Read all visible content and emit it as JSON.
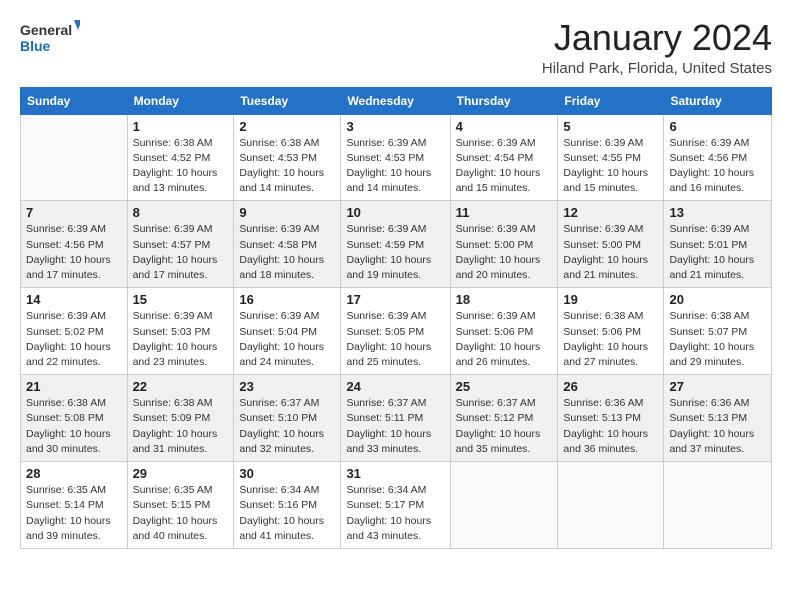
{
  "logo": {
    "line1": "General",
    "line2": "Blue"
  },
  "title": "January 2024",
  "subtitle": "Hiland Park, Florida, United States",
  "headers": [
    "Sunday",
    "Monday",
    "Tuesday",
    "Wednesday",
    "Thursday",
    "Friday",
    "Saturday"
  ],
  "weeks": [
    [
      {
        "day": "",
        "info": ""
      },
      {
        "day": "1",
        "info": "Sunrise: 6:38 AM\nSunset: 4:52 PM\nDaylight: 10 hours\nand 13 minutes."
      },
      {
        "day": "2",
        "info": "Sunrise: 6:38 AM\nSunset: 4:53 PM\nDaylight: 10 hours\nand 14 minutes."
      },
      {
        "day": "3",
        "info": "Sunrise: 6:39 AM\nSunset: 4:53 PM\nDaylight: 10 hours\nand 14 minutes."
      },
      {
        "day": "4",
        "info": "Sunrise: 6:39 AM\nSunset: 4:54 PM\nDaylight: 10 hours\nand 15 minutes."
      },
      {
        "day": "5",
        "info": "Sunrise: 6:39 AM\nSunset: 4:55 PM\nDaylight: 10 hours\nand 15 minutes."
      },
      {
        "day": "6",
        "info": "Sunrise: 6:39 AM\nSunset: 4:56 PM\nDaylight: 10 hours\nand 16 minutes."
      }
    ],
    [
      {
        "day": "7",
        "info": "Sunrise: 6:39 AM\nSunset: 4:56 PM\nDaylight: 10 hours\nand 17 minutes."
      },
      {
        "day": "8",
        "info": "Sunrise: 6:39 AM\nSunset: 4:57 PM\nDaylight: 10 hours\nand 17 minutes."
      },
      {
        "day": "9",
        "info": "Sunrise: 6:39 AM\nSunset: 4:58 PM\nDaylight: 10 hours\nand 18 minutes."
      },
      {
        "day": "10",
        "info": "Sunrise: 6:39 AM\nSunset: 4:59 PM\nDaylight: 10 hours\nand 19 minutes."
      },
      {
        "day": "11",
        "info": "Sunrise: 6:39 AM\nSunset: 5:00 PM\nDaylight: 10 hours\nand 20 minutes."
      },
      {
        "day": "12",
        "info": "Sunrise: 6:39 AM\nSunset: 5:00 PM\nDaylight: 10 hours\nand 21 minutes."
      },
      {
        "day": "13",
        "info": "Sunrise: 6:39 AM\nSunset: 5:01 PM\nDaylight: 10 hours\nand 21 minutes."
      }
    ],
    [
      {
        "day": "14",
        "info": "Sunrise: 6:39 AM\nSunset: 5:02 PM\nDaylight: 10 hours\nand 22 minutes."
      },
      {
        "day": "15",
        "info": "Sunrise: 6:39 AM\nSunset: 5:03 PM\nDaylight: 10 hours\nand 23 minutes."
      },
      {
        "day": "16",
        "info": "Sunrise: 6:39 AM\nSunset: 5:04 PM\nDaylight: 10 hours\nand 24 minutes."
      },
      {
        "day": "17",
        "info": "Sunrise: 6:39 AM\nSunset: 5:05 PM\nDaylight: 10 hours\nand 25 minutes."
      },
      {
        "day": "18",
        "info": "Sunrise: 6:39 AM\nSunset: 5:06 PM\nDaylight: 10 hours\nand 26 minutes."
      },
      {
        "day": "19",
        "info": "Sunrise: 6:38 AM\nSunset: 5:06 PM\nDaylight: 10 hours\nand 27 minutes."
      },
      {
        "day": "20",
        "info": "Sunrise: 6:38 AM\nSunset: 5:07 PM\nDaylight: 10 hours\nand 29 minutes."
      }
    ],
    [
      {
        "day": "21",
        "info": "Sunrise: 6:38 AM\nSunset: 5:08 PM\nDaylight: 10 hours\nand 30 minutes."
      },
      {
        "day": "22",
        "info": "Sunrise: 6:38 AM\nSunset: 5:09 PM\nDaylight: 10 hours\nand 31 minutes."
      },
      {
        "day": "23",
        "info": "Sunrise: 6:37 AM\nSunset: 5:10 PM\nDaylight: 10 hours\nand 32 minutes."
      },
      {
        "day": "24",
        "info": "Sunrise: 6:37 AM\nSunset: 5:11 PM\nDaylight: 10 hours\nand 33 minutes."
      },
      {
        "day": "25",
        "info": "Sunrise: 6:37 AM\nSunset: 5:12 PM\nDaylight: 10 hours\nand 35 minutes."
      },
      {
        "day": "26",
        "info": "Sunrise: 6:36 AM\nSunset: 5:13 PM\nDaylight: 10 hours\nand 36 minutes."
      },
      {
        "day": "27",
        "info": "Sunrise: 6:36 AM\nSunset: 5:13 PM\nDaylight: 10 hours\nand 37 minutes."
      }
    ],
    [
      {
        "day": "28",
        "info": "Sunrise: 6:35 AM\nSunset: 5:14 PM\nDaylight: 10 hours\nand 39 minutes."
      },
      {
        "day": "29",
        "info": "Sunrise: 6:35 AM\nSunset: 5:15 PM\nDaylight: 10 hours\nand 40 minutes."
      },
      {
        "day": "30",
        "info": "Sunrise: 6:34 AM\nSunset: 5:16 PM\nDaylight: 10 hours\nand 41 minutes."
      },
      {
        "day": "31",
        "info": "Sunrise: 6:34 AM\nSunset: 5:17 PM\nDaylight: 10 hours\nand 43 minutes."
      },
      {
        "day": "",
        "info": ""
      },
      {
        "day": "",
        "info": ""
      },
      {
        "day": "",
        "info": ""
      }
    ]
  ]
}
